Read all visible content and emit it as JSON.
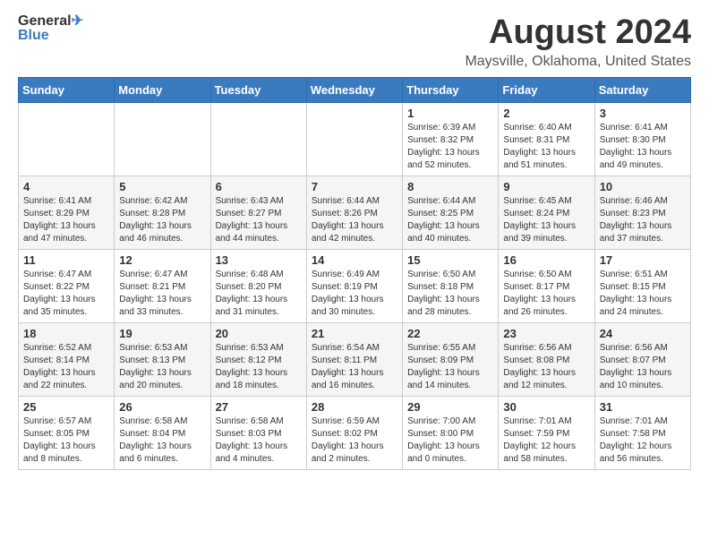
{
  "header": {
    "logo_line1_plain": "General",
    "logo_line1_colored": "",
    "logo_line2": "Blue",
    "title": "August 2024",
    "subtitle": "Maysville, Oklahoma, United States"
  },
  "calendar": {
    "weekdays": [
      "Sunday",
      "Monday",
      "Tuesday",
      "Wednesday",
      "Thursday",
      "Friday",
      "Saturday"
    ],
    "weeks": [
      [
        {
          "day": "",
          "info": ""
        },
        {
          "day": "",
          "info": ""
        },
        {
          "day": "",
          "info": ""
        },
        {
          "day": "",
          "info": ""
        },
        {
          "day": "1",
          "info": "Sunrise: 6:39 AM\nSunset: 8:32 PM\nDaylight: 13 hours\nand 52 minutes."
        },
        {
          "day": "2",
          "info": "Sunrise: 6:40 AM\nSunset: 8:31 PM\nDaylight: 13 hours\nand 51 minutes."
        },
        {
          "day": "3",
          "info": "Sunrise: 6:41 AM\nSunset: 8:30 PM\nDaylight: 13 hours\nand 49 minutes."
        }
      ],
      [
        {
          "day": "4",
          "info": "Sunrise: 6:41 AM\nSunset: 8:29 PM\nDaylight: 13 hours\nand 47 minutes."
        },
        {
          "day": "5",
          "info": "Sunrise: 6:42 AM\nSunset: 8:28 PM\nDaylight: 13 hours\nand 46 minutes."
        },
        {
          "day": "6",
          "info": "Sunrise: 6:43 AM\nSunset: 8:27 PM\nDaylight: 13 hours\nand 44 minutes."
        },
        {
          "day": "7",
          "info": "Sunrise: 6:44 AM\nSunset: 8:26 PM\nDaylight: 13 hours\nand 42 minutes."
        },
        {
          "day": "8",
          "info": "Sunrise: 6:44 AM\nSunset: 8:25 PM\nDaylight: 13 hours\nand 40 minutes."
        },
        {
          "day": "9",
          "info": "Sunrise: 6:45 AM\nSunset: 8:24 PM\nDaylight: 13 hours\nand 39 minutes."
        },
        {
          "day": "10",
          "info": "Sunrise: 6:46 AM\nSunset: 8:23 PM\nDaylight: 13 hours\nand 37 minutes."
        }
      ],
      [
        {
          "day": "11",
          "info": "Sunrise: 6:47 AM\nSunset: 8:22 PM\nDaylight: 13 hours\nand 35 minutes."
        },
        {
          "day": "12",
          "info": "Sunrise: 6:47 AM\nSunset: 8:21 PM\nDaylight: 13 hours\nand 33 minutes."
        },
        {
          "day": "13",
          "info": "Sunrise: 6:48 AM\nSunset: 8:20 PM\nDaylight: 13 hours\nand 31 minutes."
        },
        {
          "day": "14",
          "info": "Sunrise: 6:49 AM\nSunset: 8:19 PM\nDaylight: 13 hours\nand 30 minutes."
        },
        {
          "day": "15",
          "info": "Sunrise: 6:50 AM\nSunset: 8:18 PM\nDaylight: 13 hours\nand 28 minutes."
        },
        {
          "day": "16",
          "info": "Sunrise: 6:50 AM\nSunset: 8:17 PM\nDaylight: 13 hours\nand 26 minutes."
        },
        {
          "day": "17",
          "info": "Sunrise: 6:51 AM\nSunset: 8:15 PM\nDaylight: 13 hours\nand 24 minutes."
        }
      ],
      [
        {
          "day": "18",
          "info": "Sunrise: 6:52 AM\nSunset: 8:14 PM\nDaylight: 13 hours\nand 22 minutes."
        },
        {
          "day": "19",
          "info": "Sunrise: 6:53 AM\nSunset: 8:13 PM\nDaylight: 13 hours\nand 20 minutes."
        },
        {
          "day": "20",
          "info": "Sunrise: 6:53 AM\nSunset: 8:12 PM\nDaylight: 13 hours\nand 18 minutes."
        },
        {
          "day": "21",
          "info": "Sunrise: 6:54 AM\nSunset: 8:11 PM\nDaylight: 13 hours\nand 16 minutes."
        },
        {
          "day": "22",
          "info": "Sunrise: 6:55 AM\nSunset: 8:09 PM\nDaylight: 13 hours\nand 14 minutes."
        },
        {
          "day": "23",
          "info": "Sunrise: 6:56 AM\nSunset: 8:08 PM\nDaylight: 13 hours\nand 12 minutes."
        },
        {
          "day": "24",
          "info": "Sunrise: 6:56 AM\nSunset: 8:07 PM\nDaylight: 13 hours\nand 10 minutes."
        }
      ],
      [
        {
          "day": "25",
          "info": "Sunrise: 6:57 AM\nSunset: 8:05 PM\nDaylight: 13 hours\nand 8 minutes."
        },
        {
          "day": "26",
          "info": "Sunrise: 6:58 AM\nSunset: 8:04 PM\nDaylight: 13 hours\nand 6 minutes."
        },
        {
          "day": "27",
          "info": "Sunrise: 6:58 AM\nSunset: 8:03 PM\nDaylight: 13 hours\nand 4 minutes."
        },
        {
          "day": "28",
          "info": "Sunrise: 6:59 AM\nSunset: 8:02 PM\nDaylight: 13 hours\nand 2 minutes."
        },
        {
          "day": "29",
          "info": "Sunrise: 7:00 AM\nSunset: 8:00 PM\nDaylight: 13 hours\nand 0 minutes."
        },
        {
          "day": "30",
          "info": "Sunrise: 7:01 AM\nSunset: 7:59 PM\nDaylight: 12 hours\nand 58 minutes."
        },
        {
          "day": "31",
          "info": "Sunrise: 7:01 AM\nSunset: 7:58 PM\nDaylight: 12 hours\nand 56 minutes."
        }
      ]
    ]
  }
}
